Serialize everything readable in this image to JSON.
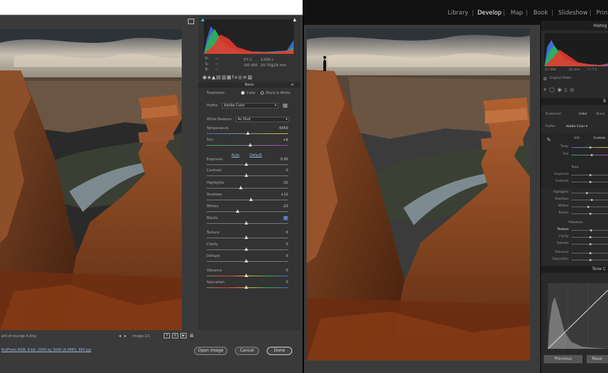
{
  "acr": {
    "filename": "arb-dr-lounge-5.dng",
    "image_counter": "Image 1/1",
    "workflow": "ProPhoto RGB; 8 bit; 2000 by 3000 (6.0MP); 300 ppi",
    "open_image": "Open Image",
    "cancel": "Cancel",
    "done": "Done",
    "exif": {
      "r": "R:",
      "g": "G:",
      "b": "B:",
      "dash": "---",
      "aperture": "f/7.1",
      "shutter": "1/100 s",
      "iso": "ISO 400",
      "lens": "24-70@24 mm"
    },
    "panel_tab": "Basic",
    "treatment": {
      "label": "Treatment:",
      "color": "Color",
      "bw": "Black & White"
    },
    "profile": {
      "label": "Profile:",
      "value": "Adobe Color"
    },
    "white_balance": {
      "label": "White Balance:",
      "value": "As Shot"
    },
    "auto": "Auto",
    "default": "Default",
    "sliders": [
      {
        "label": "Temperature",
        "value": "6450",
        "pos": 0.52
      },
      {
        "label": "Tint",
        "value": "+6",
        "pos": 0.55
      },
      {
        "label": "Exposure",
        "value": "0.00",
        "pos": 0.5
      },
      {
        "label": "Contrast",
        "value": "0",
        "pos": 0.5
      },
      {
        "label": "Highlights",
        "value": "-15",
        "pos": 0.43
      },
      {
        "label": "Shadows",
        "value": "+12",
        "pos": 0.56
      },
      {
        "label": "Whites",
        "value": "-23",
        "pos": 0.39
      },
      {
        "label": "Blacks",
        "value": "0",
        "pos": 0.5
      },
      {
        "label": "Texture",
        "value": "0",
        "pos": 0.5
      },
      {
        "label": "Clarity",
        "value": "0",
        "pos": 0.5
      },
      {
        "label": "Dehaze",
        "value": "0",
        "pos": 0.5
      },
      {
        "label": "Vibrance",
        "value": "0",
        "pos": 0.5
      },
      {
        "label": "Saturation",
        "value": "0",
        "pos": 0.5
      }
    ]
  },
  "lr": {
    "modules": [
      "Library",
      "Develop",
      "Map",
      "Book",
      "Slideshow",
      "Print"
    ],
    "active_module": "Develop",
    "panel_title": "Histog",
    "hist_values": [
      "0 / 000",
      "24 mm",
      "f / 7.1"
    ],
    "original_photo": "Original Photo",
    "basic_label": "B",
    "treatment": "Treatment:",
    "color": "Color",
    "bw": "Black",
    "profile": "Profile:",
    "profile_value": "Adobe Color",
    "wb": "WB:",
    "wb_value": "Custom",
    "temp": "Temp",
    "tint": "Tint",
    "tone": "Tone",
    "exposure": "Exposure",
    "contrast": "Contrast",
    "highlights": "Highlights",
    "shadows": "Shadows",
    "whites": "Whites",
    "blacks": "Blacks",
    "presence": "Presence",
    "texture": "Texture",
    "clarity": "Clarity",
    "dehaze": "Dehaze",
    "vibrance": "Vibrance",
    "saturation": "Saturation",
    "tone_curve": "Tone C",
    "previous": "Previous",
    "reset": "Rese"
  }
}
